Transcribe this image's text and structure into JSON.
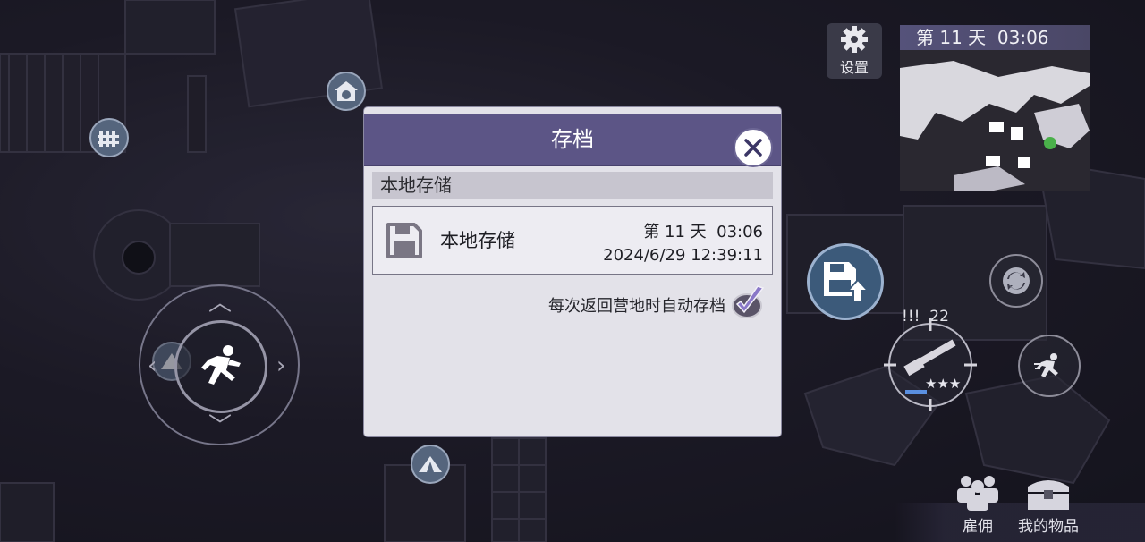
{
  "hud": {
    "settings_label": "设置",
    "day_time": "第 11 天  03:06",
    "ammo": "!!!  22",
    "weapon_stars": "★★★",
    "hire_label": "雇佣",
    "inventory_label": "我的物品"
  },
  "dialog": {
    "title": "存档",
    "section_title": "本地存储",
    "slot": {
      "name": "本地存储",
      "day_time": "第 11 天  03:06",
      "datetime": "2024/6/29 12:39:11"
    },
    "auto_save_label": "每次返回营地时自动存档",
    "auto_save_checked": true
  },
  "colors": {
    "dialog_header": "#5c5586",
    "dialog_body": "#e3e2e9",
    "accent_check": "#6b5fa0"
  },
  "icons": {
    "settings": "gear-icon",
    "close": "close-icon",
    "slot": "floppy-disk-icon",
    "checkbox": "checkmark-icon",
    "save_upload": "floppy-upload-icon",
    "switch": "refresh-icon",
    "sprint": "running-man-icon",
    "hire": "people-icon",
    "inventory": "chest-icon"
  }
}
